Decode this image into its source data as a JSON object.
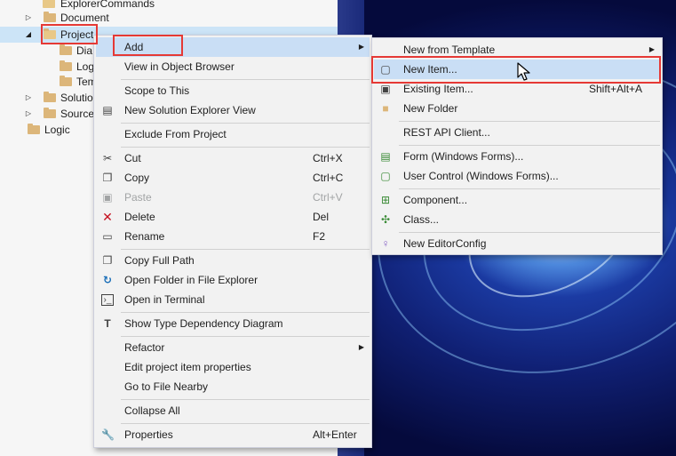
{
  "tree": {
    "items": [
      {
        "label": "ExplorerCommands",
        "arrow": "",
        "open": true
      },
      {
        "label": "Document",
        "arrow": "▷",
        "open": false
      },
      {
        "label": "Project",
        "arrow": "◢",
        "open": true
      },
      {
        "label": "Dia",
        "arrow": "",
        "open": false
      },
      {
        "label": "Log",
        "arrow": "",
        "open": false
      },
      {
        "label": "Tem",
        "arrow": "",
        "open": false
      },
      {
        "label": "Solution",
        "arrow": "▷",
        "open": false
      },
      {
        "label": "Source",
        "arrow": "▷",
        "open": false
      },
      {
        "label": "Logic",
        "arrow": "",
        "open": false
      }
    ]
  },
  "context_menu": {
    "items": [
      {
        "label": "Add",
        "shortcut": "",
        "icon": "",
        "submenu": true
      },
      {
        "label": "View in Object Browser",
        "shortcut": "",
        "icon": "",
        "submenu": false
      },
      {
        "label": "Scope to This",
        "shortcut": "",
        "icon": "",
        "submenu": false
      },
      {
        "label": "New Solution Explorer View",
        "shortcut": "",
        "icon": "new-view-icon",
        "submenu": false
      },
      {
        "label": "Exclude From Project",
        "shortcut": "",
        "icon": "",
        "submenu": false
      },
      {
        "label": "Cut",
        "shortcut": "Ctrl+X",
        "icon": "cut-icon",
        "submenu": false
      },
      {
        "label": "Copy",
        "shortcut": "Ctrl+C",
        "icon": "copy-icon",
        "submenu": false
      },
      {
        "label": "Paste",
        "shortcut": "Ctrl+V",
        "icon": "paste-icon",
        "submenu": false,
        "disabled": true
      },
      {
        "label": "Delete",
        "shortcut": "Del",
        "icon": "delete-icon",
        "submenu": false
      },
      {
        "label": "Rename",
        "shortcut": "F2",
        "icon": "rename-icon",
        "submenu": false
      },
      {
        "label": "Copy Full Path",
        "shortcut": "",
        "icon": "copy-path-icon",
        "submenu": false
      },
      {
        "label": "Open Folder in File Explorer",
        "shortcut": "",
        "icon": "open-folder-icon",
        "submenu": false
      },
      {
        "label": "Open in Terminal",
        "shortcut": "",
        "icon": "terminal-icon",
        "submenu": false
      },
      {
        "label": "Show Type Dependency Diagram",
        "shortcut": "",
        "icon": "diagram-icon",
        "submenu": false
      },
      {
        "label": "Refactor",
        "shortcut": "",
        "icon": "",
        "submenu": true
      },
      {
        "label": "Edit project item properties",
        "shortcut": "",
        "icon": "",
        "submenu": false
      },
      {
        "label": "Go to File Nearby",
        "shortcut": "",
        "icon": "",
        "submenu": false
      },
      {
        "label": "Collapse All",
        "shortcut": "",
        "icon": "",
        "submenu": false
      },
      {
        "label": "Properties",
        "shortcut": "Alt+Enter",
        "icon": "wrench-icon",
        "submenu": false
      }
    ]
  },
  "add_submenu": {
    "items": [
      {
        "label": "New from Template",
        "shortcut": "",
        "icon": "",
        "submenu": true
      },
      {
        "label": "New Item...",
        "shortcut": "",
        "icon": "new-item-icon",
        "submenu": false
      },
      {
        "label": "Existing Item...",
        "shortcut": "Shift+Alt+A",
        "icon": "existing-item-icon",
        "submenu": false
      },
      {
        "label": "New Folder",
        "shortcut": "",
        "icon": "new-folder-icon",
        "submenu": false
      },
      {
        "label": "REST API Client...",
        "shortcut": "",
        "icon": "",
        "submenu": false
      },
      {
        "label": "Form (Windows Forms)...",
        "shortcut": "",
        "icon": "form-icon",
        "submenu": false
      },
      {
        "label": "User Control (Windows Forms)...",
        "shortcut": "",
        "icon": "user-control-icon",
        "submenu": false
      },
      {
        "label": "Component...",
        "shortcut": "",
        "icon": "component-icon",
        "submenu": false
      },
      {
        "label": "Class...",
        "shortcut": "",
        "icon": "class-icon",
        "submenu": false
      },
      {
        "label": "New EditorConfig",
        "shortcut": "",
        "icon": "editorconfig-icon",
        "submenu": false
      }
    ]
  },
  "colors": {
    "highlight": "#c9def5",
    "annotation_red": "#e53935",
    "menu_bg": "#f2f2f2"
  }
}
